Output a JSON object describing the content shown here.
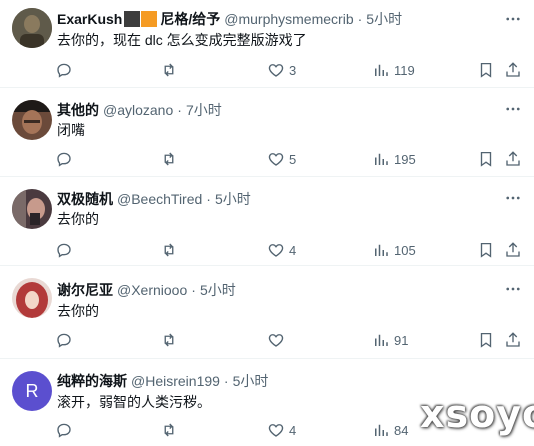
{
  "posts": [
    {
      "name": "ExarKush",
      "name_suffix": "尼格/给予",
      "badge_colors": [
        "#3d3d3d",
        "#f59b23"
      ],
      "handle": "@murphysmemecrib",
      "time": "5小时",
      "text": "去你的，现在 dlc 怎么变成完整版游戏了",
      "avatar": {
        "bg": "#5f5a4a"
      },
      "likes": "3",
      "views": "119"
    },
    {
      "name": "其他的",
      "handle": "@aylozano",
      "time": "7小时",
      "text": "闭嘴",
      "avatar": {
        "bg": "#6b4a3a"
      },
      "likes": "5",
      "views": "195"
    },
    {
      "name": "双极随机",
      "handle": "@BeechTired",
      "time": "5小时",
      "text": "去你的",
      "avatar": {
        "bg": "#4a3a3f"
      },
      "likes": "4",
      "views": "105"
    },
    {
      "name": "谢尔尼亚",
      "handle": "@Xerniooo",
      "time": "5小时",
      "text": "去你的",
      "avatar": {
        "bg": "#b23a3a"
      },
      "likes": "",
      "views": "91"
    },
    {
      "name": "纯粹的海斯",
      "handle": "@Heisrein199",
      "time": "5小时",
      "text": "滚开，弱智的人类污秽。",
      "avatar": {
        "letter": "R",
        "bg": "#5b4fcf"
      },
      "likes": "4",
      "views": "84"
    }
  ],
  "separator": "·",
  "icons": {
    "reply": "reply-icon",
    "repost": "repost-icon",
    "like": "heart-icon",
    "views": "analytics-icon",
    "bookmark": "bookmark-icon",
    "share": "share-icon",
    "more": "more-icon"
  },
  "watermark": "xsoyo",
  "colors": {
    "text_primary": "#0f1419",
    "text_secondary": "#536471",
    "divider": "#eff3f4"
  }
}
